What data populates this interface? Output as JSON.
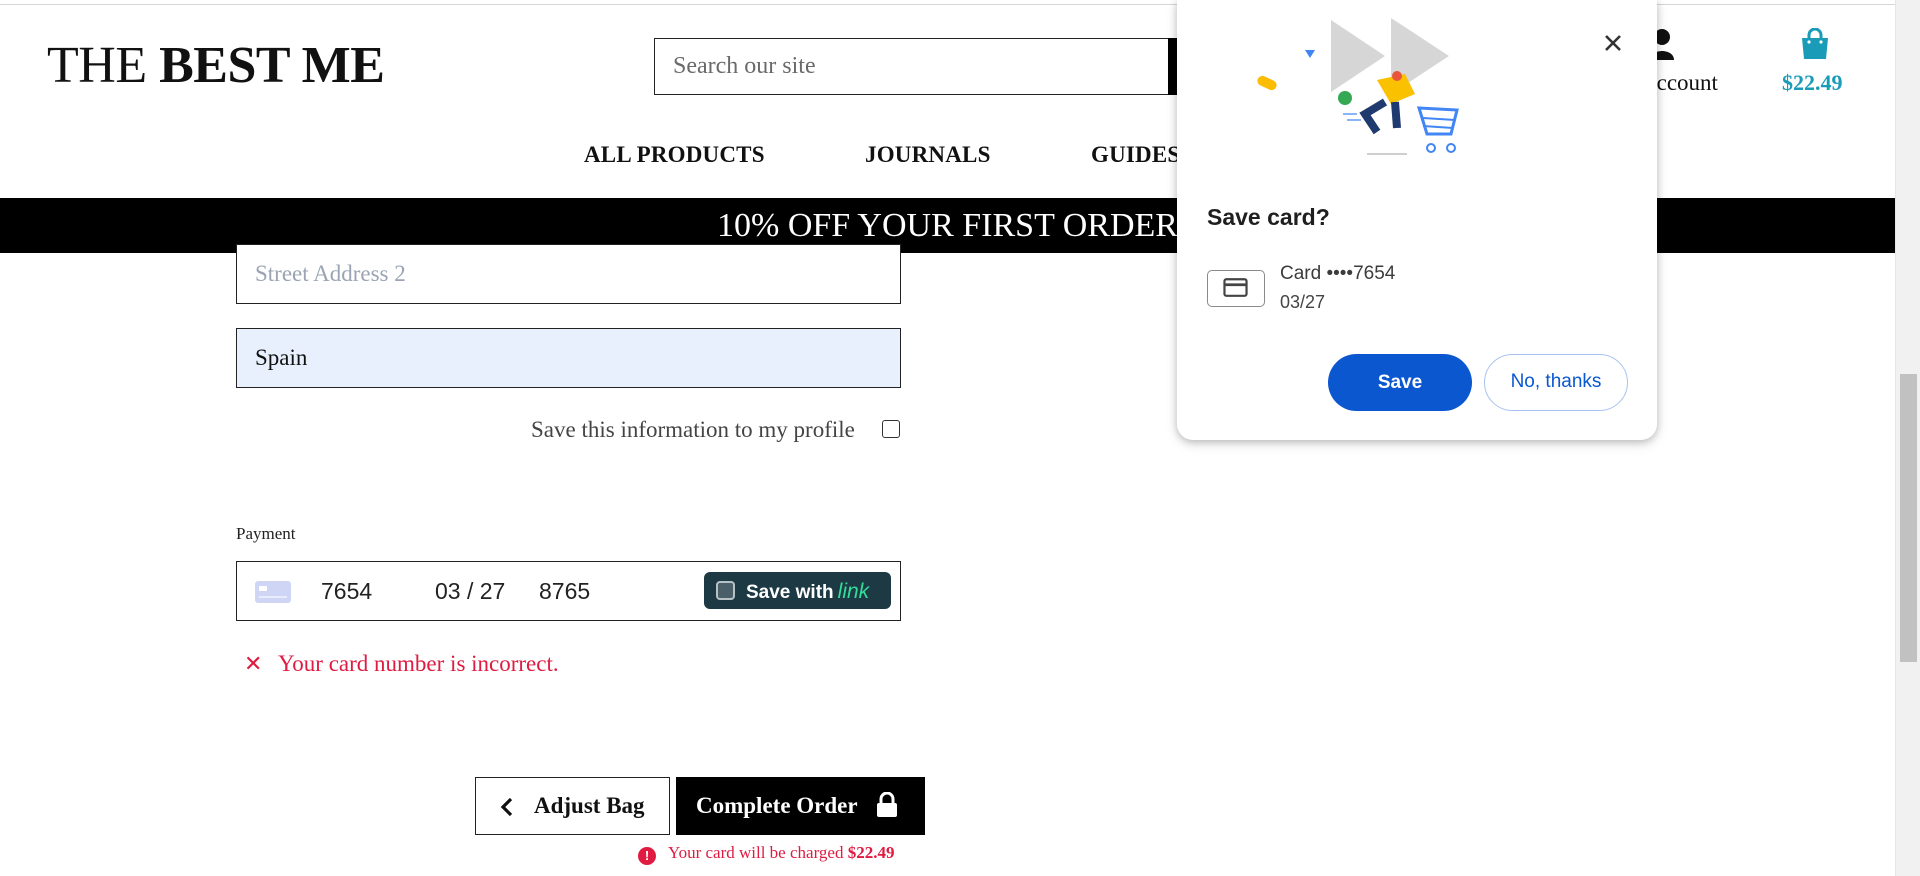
{
  "header": {
    "logo_light": "THE",
    "logo_bold": "BEST ME",
    "search_placeholder": "Search our site",
    "account_label": "Account",
    "cart_amount": "$22.49",
    "nav": [
      "ALL PRODUCTS",
      "JOURNALS",
      "GUIDES"
    ]
  },
  "banner": {
    "text": "10% OFF YOUR FIRST ORDER"
  },
  "form": {
    "street2_placeholder": "Street Address 2",
    "country_value": "Spain",
    "save_profile_label": "Save this information to my profile",
    "save_profile_checked": false
  },
  "payment": {
    "label": "Payment",
    "card_number": "7654",
    "expiry": "03 / 27",
    "cvc": "8765",
    "link_label": "Save with",
    "link_brand": "link",
    "error": "Your card number is incorrect."
  },
  "actions": {
    "adjust_label": "Adjust Bag",
    "complete_label": "Complete Order",
    "charge_prefix": "Your card will be charged",
    "charge_amount": "$22.49"
  },
  "popup": {
    "title": "Save card?",
    "card_name": "Card  ••••7654",
    "card_expiry": "03/27",
    "save_label": "Save",
    "dismiss_label": "No, thanks"
  },
  "colors": {
    "accent_teal": "#1a9bb8",
    "error_red": "#df1b41",
    "google_blue": "#0b57d0",
    "link_green": "#33dd99",
    "autofill_bg": "#e8f0fe"
  }
}
